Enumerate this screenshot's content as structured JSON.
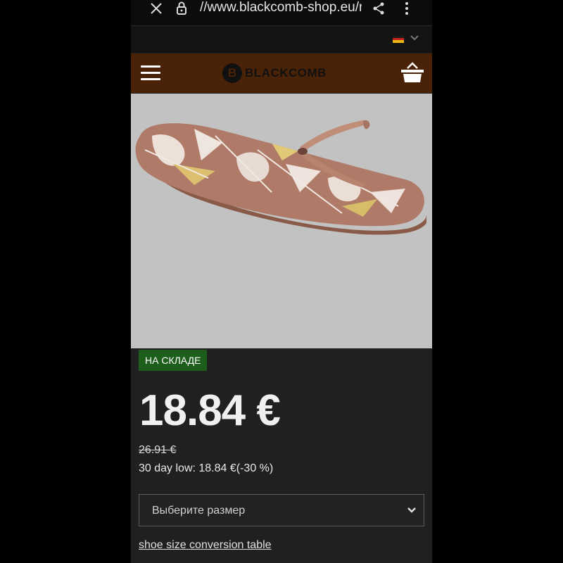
{
  "browser": {
    "url": "//www.blackcomb-shop.eu/r",
    "icons": [
      "close-icon",
      "lock-icon",
      "share-icon",
      "more-vert-icon"
    ]
  },
  "language": {
    "flag": "germany-flag-icon",
    "flag_colors": [
      "#1a1a1a",
      "#c8241c",
      "#e8b818"
    ]
  },
  "header": {
    "logo_text": "BLACKCOMB",
    "logo_mark": "B",
    "background": "#4a2208",
    "icons": [
      "hamburger-menu-icon",
      "basket-icon"
    ]
  },
  "product": {
    "image": "flip-flop-sandal-image",
    "stock_label": "НА СКЛАДЕ",
    "price": "18.84 €",
    "old_price": "26.91 €",
    "low_price_text": "30 day low: 18.84 €(-30 %)",
    "size_placeholder": "Выберите размер",
    "size_table_link": "shoe size conversion table"
  }
}
